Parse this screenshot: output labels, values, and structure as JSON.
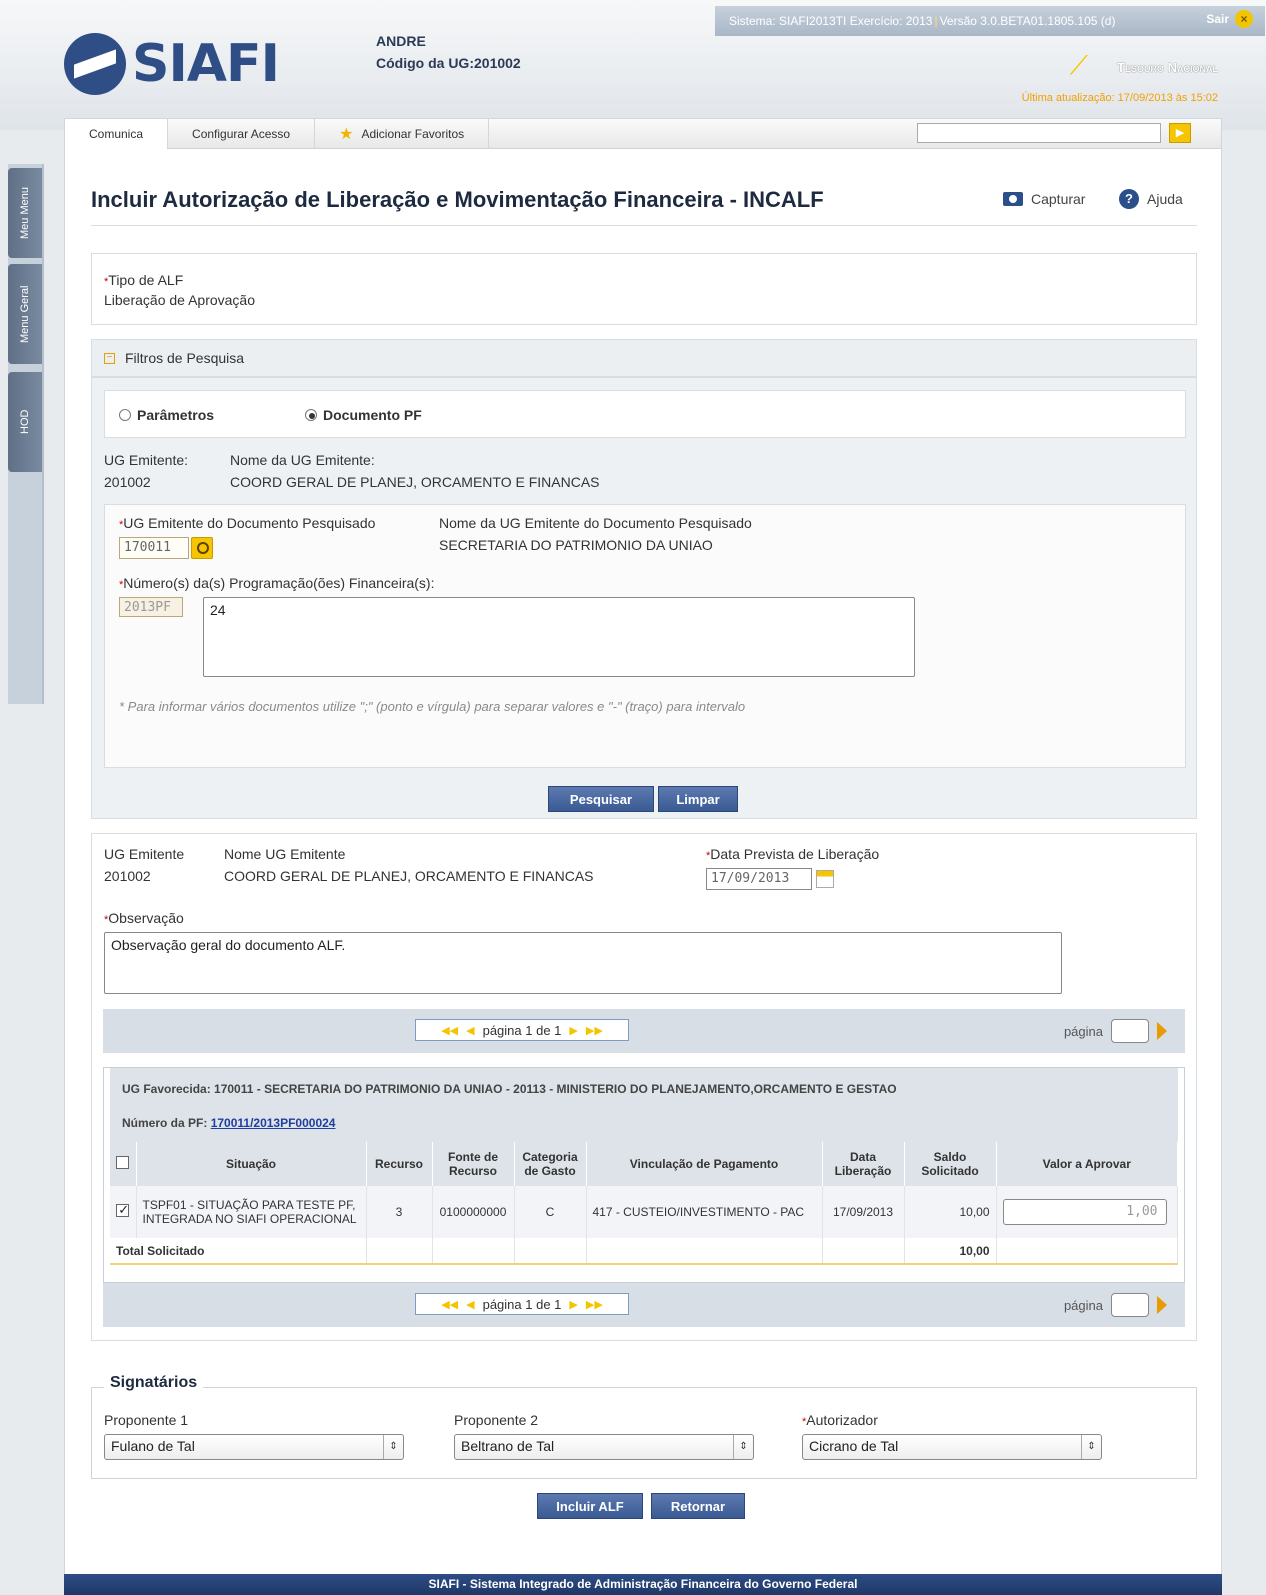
{
  "header": {
    "logo_text": "SIAFI",
    "user_name": "ANDRE",
    "ug_code_label": "Código da UG:",
    "ug_code": "201002",
    "system_info": "Sistema: SIAFI2013TI Exercício: 2013",
    "version_info": "Versão 3.0.BETA01.1805.105 (d)",
    "logout_label": "Sair",
    "brand": "Tesouro Nacional",
    "last_update": "Última atualização: 17/09/2013 às 15:02"
  },
  "side_tabs": [
    "Meu Menu",
    "Menu Geral",
    "HOD"
  ],
  "topnav": {
    "items": [
      "Comunica",
      "Configurar Acesso",
      "Adicionar Favoritos"
    ],
    "search_value": ""
  },
  "page": {
    "title": "Incluir Autorização de Liberação e Movimentação Financeira - INCALF",
    "capture_label": "Capturar",
    "help_label": "Ajuda"
  },
  "tipo_alf": {
    "label": "Tipo de ALF",
    "value": "Liberação de Aprovação"
  },
  "filters": {
    "title": "Filtros de Pesquisa",
    "radio_params": "Parâmetros",
    "radio_doc": "Documento PF",
    "ug_emitente_label": "UG Emitente:",
    "ug_emitente_value": "201002",
    "nome_ug_label": "Nome da UG Emitente:",
    "nome_ug_value": "COORD GERAL DE PLANEJ, ORCAMENTO E FINANCAS",
    "ug_doc_label": "UG Emitente do Documento Pesquisado",
    "ug_doc_value": "170011",
    "nome_ug_doc_label": "Nome da UG Emitente do Documento Pesquisado",
    "nome_ug_doc_value": "SECRETARIA DO PATRIMONIO DA UNIAO",
    "pf_numbers_label": "Número(s) da(s) Programação(ões) Financeira(s):",
    "pf_prefix": "2013PF",
    "pf_numbers_value": "24",
    "hint": "* Para informar vários documentos utilize \";\" (ponto e vírgula) para separar valores e \"-\" (traço) para intervalo",
    "search_button": "Pesquisar",
    "clear_button": "Limpar"
  },
  "document": {
    "ug_emitente_label": "UG Emitente",
    "ug_emitente_value": "201002",
    "nome_ug_label": "Nome UG Emitente",
    "nome_ug_value": "COORD GERAL DE PLANEJ, ORCAMENTO E FINANCAS",
    "data_prevista_label": "Data Prevista de Liberação",
    "data_prevista_value": "17/09/2013",
    "obs_label": "Observação",
    "obs_value": "Observação geral do documento ALF."
  },
  "pagination": {
    "text": "página 1 de 1",
    "goto_label": "página"
  },
  "grid": {
    "ug_favorecida": "UG Favorecida: 170011 - SECRETARIA DO PATRIMONIO DA UNIAO - 20113 - MINISTERIO DO PLANEJAMENTO,ORCAMENTO E GESTAO",
    "pf_label": "Número da PF:",
    "pf_link": "170011/2013PF000024",
    "columns": [
      "Situação",
      "Recurso",
      "Fonte de Recurso",
      "Categoria de Gasto",
      "Vinculação de Pagamento",
      "Data Liberação",
      "Saldo Solicitado",
      "Valor a Aprovar"
    ],
    "rows": [
      {
        "situacao": "TSPF01 - SITUAÇÃO PARA TESTE PF, INTEGRADA NO SIAFI OPERACIONAL",
        "recurso": "3",
        "fonte": "0100000000",
        "categoria": "C",
        "vinculacao": "417 - CUSTEIO/INVESTIMENTO - PAC",
        "data": "17/09/2013",
        "saldo": "10,00",
        "valor": "1,00"
      }
    ],
    "total_label": "Total Solicitado",
    "total_value": "10,00"
  },
  "signatarios": {
    "title": "Signatários",
    "proponente1_label": "Proponente 1",
    "proponente1_value": "Fulano de Tal",
    "proponente2_label": "Proponente 2",
    "proponente2_value": "Beltrano de Tal",
    "autorizador_label": "Autorizador",
    "autorizador_value": "Cicrano de Tal"
  },
  "actions": {
    "include_button": "Incluir ALF",
    "return_button": "Retornar"
  },
  "footer": "SIAFI - Sistema Integrado de Administração Financeira do Governo Federal"
}
